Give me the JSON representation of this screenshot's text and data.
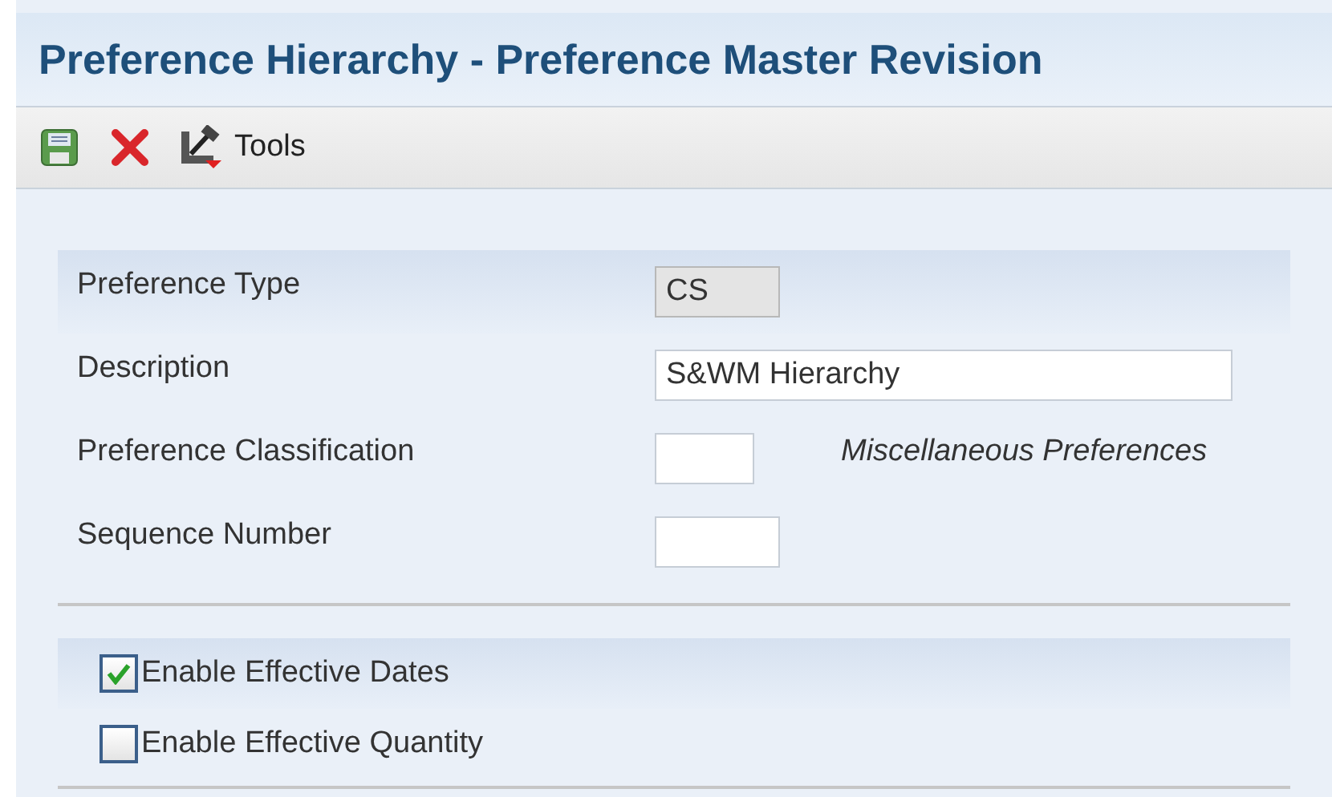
{
  "window": {
    "title": "Preference Hierarchy - Preference Master Revision"
  },
  "toolbar": {
    "tools_label": "Tools"
  },
  "fields": [
    {
      "label": "Preference Type",
      "value": "CS",
      "disabled": true
    },
    {
      "label": "Description",
      "value": "S&WM Hierarchy",
      "disabled": false
    },
    {
      "label": "Preference Classification",
      "disabled": false,
      "description": "Miscellaneous Preferences"
    },
    {
      "label": "Sequence Number",
      "disabled": false
    }
  ],
  "options": [
    {
      "label": "Enable Effective Dates",
      "checked": true
    },
    {
      "label": "Enable Effective Quantity",
      "checked": false
    }
  ]
}
